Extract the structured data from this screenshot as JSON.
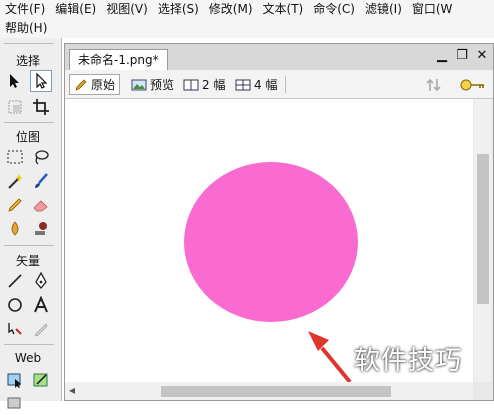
{
  "menu": {
    "row1": [
      "文件(F)",
      "编辑(E)",
      "视图(V)",
      "选择(S)",
      "修改(M)",
      "文本(T)",
      "命令(C)",
      "滤镜(I)",
      "窗口(W"
    ],
    "row2": [
      "帮助(H)"
    ]
  },
  "tools": {
    "sections": {
      "select": "选择",
      "bitmap": "位图",
      "vector": "矢量",
      "web": "Web"
    }
  },
  "document": {
    "tab_title": "未命名-1.png*",
    "view_modes": {
      "original": "原始",
      "preview": "预览",
      "two_up": "2 幅",
      "four_up": "4 幅"
    },
    "circle_color": "#f96bd0",
    "arrow_color": "#e0352b"
  },
  "watermark": "软件技巧"
}
